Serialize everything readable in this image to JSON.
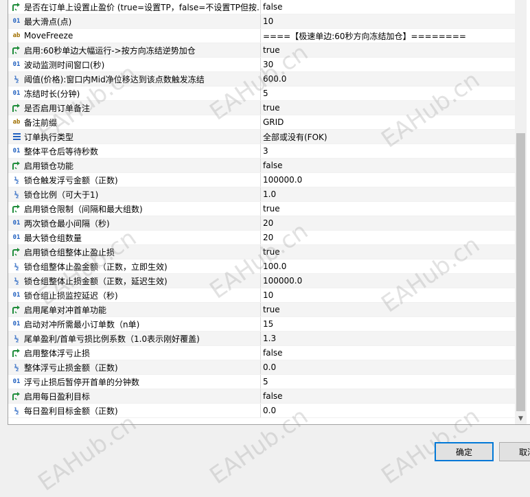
{
  "parameters": [
    {
      "icon": "bool",
      "name": "是否在订单上设置止盈价 (true=设置TP，false=不设置TP但按…",
      "value": "false"
    },
    {
      "icon": "int",
      "name": "最大滑点(点)",
      "value": "10"
    },
    {
      "icon": "str",
      "name": "MoveFreeze",
      "value": "====【极速单边:60秒方向冻结加仓】========"
    },
    {
      "icon": "bool",
      "name": "启用:60秒单边大幅运行->按方向冻结逆势加仓",
      "value": "true"
    },
    {
      "icon": "int",
      "name": "波动监测时间窗口(秒)",
      "value": "30"
    },
    {
      "icon": "dbl",
      "name": "阈值(价格):窗口内Mid净位移达到该点数触发冻结",
      "value": "600.0"
    },
    {
      "icon": "int",
      "name": "冻结时长(分钟)",
      "value": "5"
    },
    {
      "icon": "bool",
      "name": "是否启用订单备注",
      "value": "true"
    },
    {
      "icon": "str",
      "name": "备注前缀",
      "value": "GRID"
    },
    {
      "icon": "enum",
      "name": "订单执行类型",
      "value": "全部或没有(FOK)"
    },
    {
      "icon": "int",
      "name": "整体平仓后等待秒数",
      "value": "3"
    },
    {
      "icon": "bool",
      "name": "启用锁仓功能",
      "value": "false"
    },
    {
      "icon": "dbl",
      "name": "锁仓触发浮亏金额（正数)",
      "value": "100000.0"
    },
    {
      "icon": "dbl",
      "name": "锁仓比例（可大于1)",
      "value": "1.0"
    },
    {
      "icon": "bool",
      "name": "启用锁仓限制（间隔和最大组数)",
      "value": "true"
    },
    {
      "icon": "int",
      "name": "两次锁仓最小间隔（秒)",
      "value": "20"
    },
    {
      "icon": "int",
      "name": "最大锁仓组数量",
      "value": "20"
    },
    {
      "icon": "bool",
      "name": "启用锁仓组整体止盈止损",
      "value": "true"
    },
    {
      "icon": "dbl",
      "name": "锁仓组整体止盈金额（正数，立即生效)",
      "value": "100.0"
    },
    {
      "icon": "dbl",
      "name": "锁仓组整体止损金额（正数，延迟生效)",
      "value": "100000.0"
    },
    {
      "icon": "int",
      "name": "锁仓组止损监控延迟（秒)",
      "value": "10"
    },
    {
      "icon": "bool",
      "name": "启用尾单对冲首单功能",
      "value": "true"
    },
    {
      "icon": "int",
      "name": "启动对冲所需最小订单数（n单)",
      "value": "15"
    },
    {
      "icon": "dbl",
      "name": "尾单盈利/首单亏损比例系数（1.0表示刚好覆盖)",
      "value": "1.3"
    },
    {
      "icon": "bool",
      "name": "启用整体浮亏止损",
      "value": "false"
    },
    {
      "icon": "dbl",
      "name": "整体浮亏止损金额（正数)",
      "value": "0.0"
    },
    {
      "icon": "int",
      "name": "浮亏止损后暂停开首单的分钟数",
      "value": "5"
    },
    {
      "icon": "bool",
      "name": "启用每日盈利目标",
      "value": "false"
    },
    {
      "icon": "dbl",
      "name": "每日盈利目标金额（正数)",
      "value": "0.0"
    }
  ],
  "icon_glyphs": {
    "bool": "bool-arrow-icon",
    "int": "01",
    "str": "ab",
    "dbl": "½",
    "enum": "enum-list-icon"
  },
  "colors": {
    "bool_icon": "#1e8c3a",
    "int_icon": "#1f5fbf",
    "str_icon": "#a07000",
    "ok_border": "#0078d7"
  },
  "watermark_text": "EAHub.cn",
  "buttons": {
    "ok_label": "确定",
    "cancel_label": "取消"
  }
}
